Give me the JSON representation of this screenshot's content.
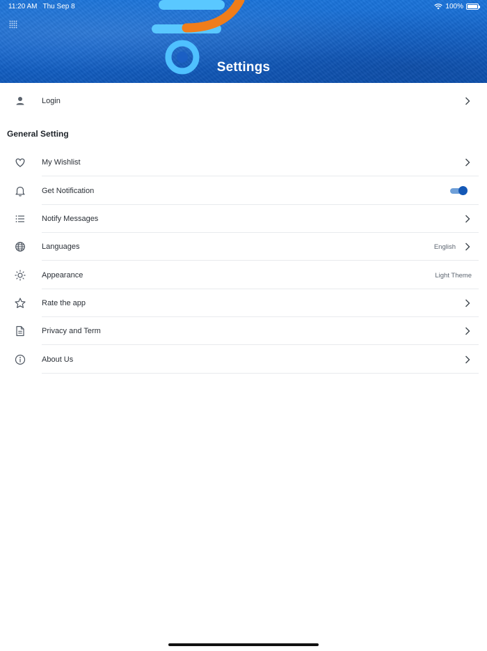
{
  "status_bar": {
    "time": "11:20 AM",
    "date": "Thu Sep 8",
    "battery": "100%"
  },
  "header": {
    "title": "Settings"
  },
  "login": {
    "label": "Login"
  },
  "general": {
    "section_title": "General Setting",
    "items": [
      {
        "label": "My Wishlist",
        "icon": "heart-icon"
      },
      {
        "label": "Get Notification",
        "icon": "bell-icon",
        "toggle_on": true
      },
      {
        "label": "Notify Messages",
        "icon": "list-icon"
      },
      {
        "label": "Languages",
        "icon": "globe-icon",
        "value": "English"
      },
      {
        "label": "Appearance",
        "icon": "sun-icon",
        "value": "Light Theme"
      },
      {
        "label": "Rate the app",
        "icon": "star-icon"
      },
      {
        "label": "Privacy and Term",
        "icon": "document-icon"
      },
      {
        "label": "About Us",
        "icon": "info-icon"
      }
    ]
  },
  "colors": {
    "header_blue": "#1565cc",
    "accent": "#1458b6",
    "orange": "#f07d1a"
  }
}
